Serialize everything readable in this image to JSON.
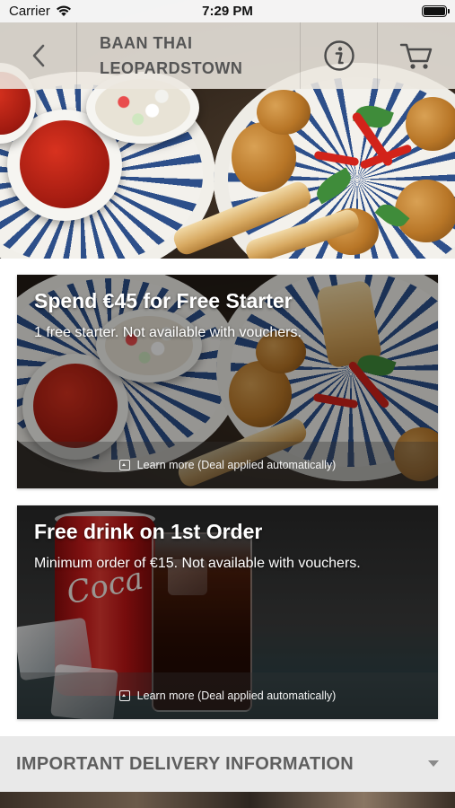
{
  "status_bar": {
    "carrier": "Carrier",
    "time": "7:29 PM"
  },
  "nav": {
    "title_line1": "BAAN THAI",
    "title_line2": "LEOPARDSTOWN",
    "back_icon": "chevron-left-icon",
    "info_icon": "info-icon",
    "cart_icon": "cart-icon"
  },
  "deals": [
    {
      "title": "Spend €45 for Free Starter",
      "description": "1 free starter. Not available with vouchers.",
      "learn_more": "Learn more (Deal applied automatically)"
    },
    {
      "title": "Free drink on 1st Order",
      "description": "Minimum order of €15. Not available with vouchers.",
      "learn_more": "Learn more (Deal applied automatically)"
    }
  ],
  "delivery": {
    "label": "IMPORTANT DELIVERY INFORMATION"
  },
  "can_text": "Coca"
}
